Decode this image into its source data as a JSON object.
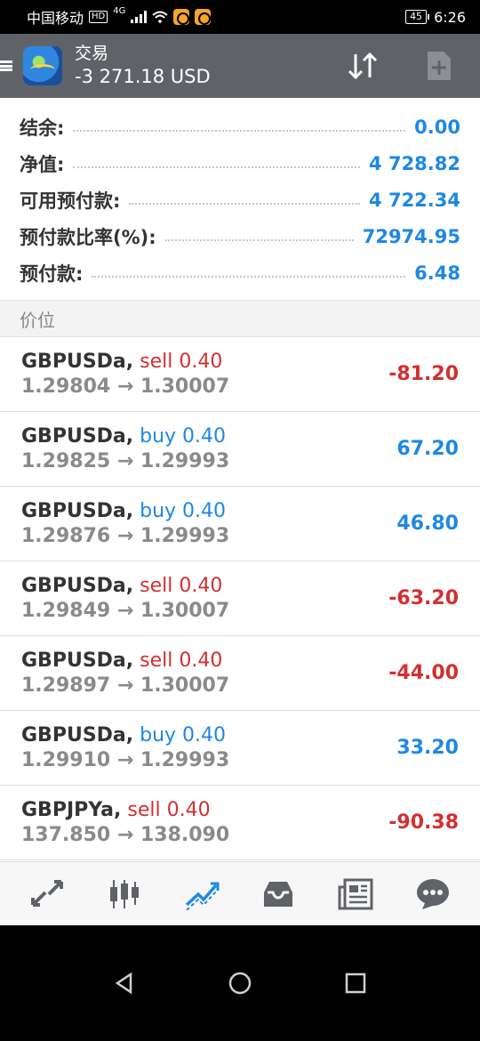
{
  "status_bar": {
    "carrier": "中国移动",
    "hd_badge": "HD",
    "network": "4G",
    "battery": "45",
    "time": "6:26"
  },
  "header": {
    "title": "交易",
    "balance_summary": "-3 271.18 USD"
  },
  "summary": [
    {
      "label": "结余:",
      "value": "0.00"
    },
    {
      "label": "净值:",
      "value": "4 728.82"
    },
    {
      "label": "可用预付款:",
      "value": "4 722.34"
    },
    {
      "label": "预付款比率(%):",
      "value": "72974.95"
    },
    {
      "label": "预付款:",
      "value": "6.48"
    }
  ],
  "section_title": "价位",
  "positions": [
    {
      "symbol": "GBPUSDa,",
      "side": "sell 0.40",
      "prices": "1.29804 → 1.30007",
      "profit": "-81.20"
    },
    {
      "symbol": "GBPUSDa,",
      "side": "buy 0.40",
      "prices": "1.29825 → 1.29993",
      "profit": "67.20"
    },
    {
      "symbol": "GBPUSDa,",
      "side": "buy 0.40",
      "prices": "1.29876 → 1.29993",
      "profit": "46.80"
    },
    {
      "symbol": "GBPUSDa,",
      "side": "sell 0.40",
      "prices": "1.29849 → 1.30007",
      "profit": "-63.20"
    },
    {
      "symbol": "GBPUSDa,",
      "side": "sell 0.40",
      "prices": "1.29897 → 1.30007",
      "profit": "-44.00"
    },
    {
      "symbol": "GBPUSDa,",
      "side": "buy 0.40",
      "prices": "1.29910 → 1.29993",
      "profit": "33.20"
    },
    {
      "symbol": "GBPJPYa,",
      "side": "sell 0.40",
      "prices": "137.850 → 138.090",
      "profit": "-90.38"
    }
  ],
  "bottom_nav": [
    {
      "name": "quotes-icon",
      "active": false
    },
    {
      "name": "chart-icon",
      "active": false
    },
    {
      "name": "trade-icon",
      "active": true
    },
    {
      "name": "history-icon",
      "active": false
    },
    {
      "name": "news-icon",
      "active": false
    },
    {
      "name": "chat-icon",
      "active": false
    }
  ],
  "colors": {
    "header_bg": "#5f6368",
    "positive": "#1e88e5",
    "negative": "#d32f2f",
    "nav_icon": "#5f6368",
    "nav_active": "#1e88e5"
  }
}
